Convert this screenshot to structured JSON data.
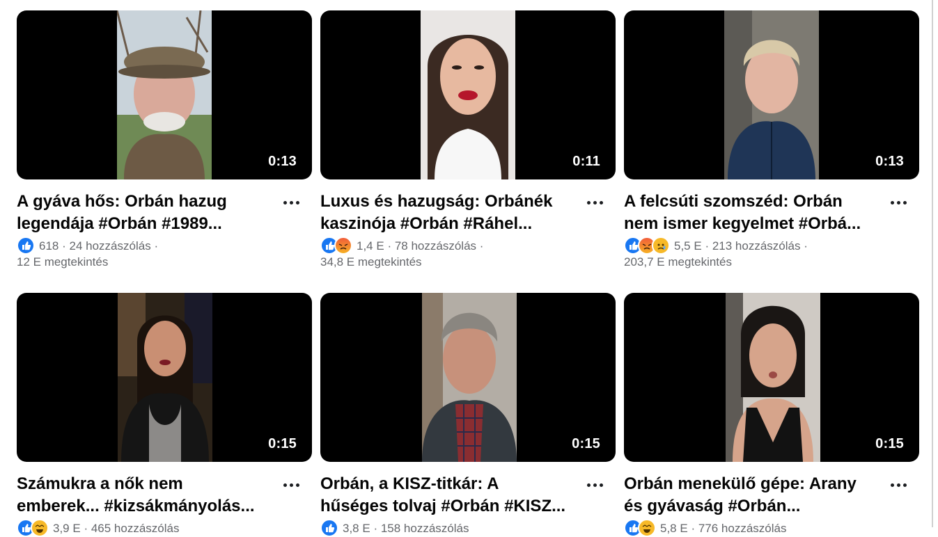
{
  "videos": [
    {
      "duration": "0:13",
      "title_line1": "A gyáva hős: Orbán hazug",
      "title_line2": "legendája #Orbán #1989...",
      "reactions": [
        "like"
      ],
      "reaction_count": "618",
      "sep1": "·",
      "comments": "24 hozzászólás",
      "sep2": "·",
      "views": "12 E megtekintés"
    },
    {
      "duration": "0:11",
      "title_line1": "Luxus és hazugság: Orbánék",
      "title_line2": "kaszinója #Orbán #Ráhel...",
      "reactions": [
        "like",
        "angry"
      ],
      "reaction_count": "1,4 E",
      "sep1": "·",
      "comments": "78 hozzászólás",
      "sep2": "·",
      "views": "34,8 E megtekintés"
    },
    {
      "duration": "0:13",
      "title_line1": "A felcsúti szomszéd: Orbán",
      "title_line2": "nem ismer kegyelmet #Orbá...",
      "reactions": [
        "like",
        "angry",
        "sad"
      ],
      "reaction_count": "5,5 E",
      "sep1": "·",
      "comments": "213 hozzászólás",
      "sep2": "·",
      "views": "203,7 E megtekintés"
    },
    {
      "duration": "0:15",
      "title_line1": "Számukra a nők nem",
      "title_line2": "emberek... #kizsákmányolás...",
      "reactions": [
        "like",
        "haha"
      ],
      "reaction_count": "3,9 E",
      "sep1": "·",
      "comments": "465 hozzászólás",
      "sep2": "",
      "views": ""
    },
    {
      "duration": "0:15",
      "title_line1": "Orbán, a KISZ-titkár: A",
      "title_line2": "hűséges tolvaj #Orbán #KISZ...",
      "reactions": [
        "like"
      ],
      "reaction_count": "3,8 E",
      "sep1": "·",
      "comments": "158 hozzászólás",
      "sep2": "",
      "views": ""
    },
    {
      "duration": "0:15",
      "title_line1": "Orbán menekülő gépe: Arany",
      "title_line2": "és gyávaság #Orbán...",
      "reactions": [
        "like",
        "haha"
      ],
      "reaction_count": "5,8 E",
      "sep1": "·",
      "comments": "776 hozzászólás",
      "sep2": "",
      "views": ""
    }
  ],
  "colors": {
    "like": "#1877f2",
    "angry": "#f15c3a",
    "sad": "#f7b928",
    "text": "#050505",
    "meta": "#65676b"
  },
  "icons": {
    "more": "more-horizontal-icon",
    "like": "like-reaction-icon",
    "angry": "angry-reaction-icon",
    "sad": "sad-reaction-icon",
    "haha": "haha-reaction-icon"
  }
}
